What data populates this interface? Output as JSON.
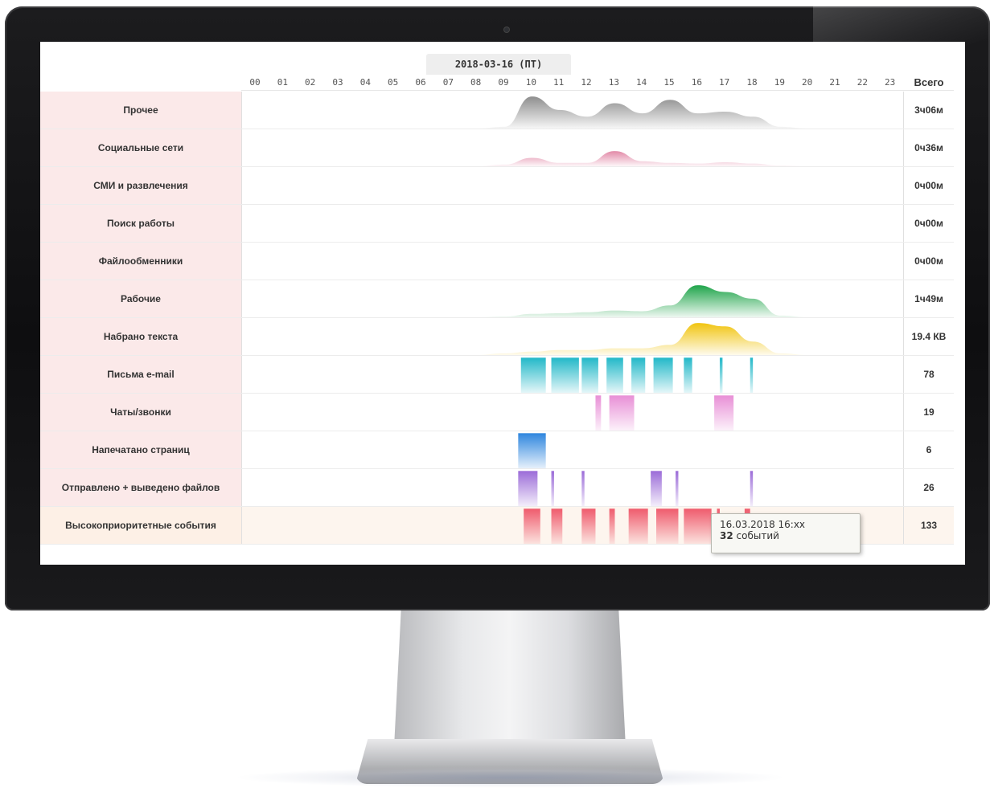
{
  "screen": {
    "date_tab": "2018-03-16 (ПТ)",
    "hours": [
      "00",
      "01",
      "02",
      "03",
      "04",
      "05",
      "06",
      "07",
      "08",
      "09",
      "10",
      "11",
      "12",
      "13",
      "14",
      "15",
      "16",
      "17",
      "18",
      "19",
      "20",
      "21",
      "22",
      "23"
    ],
    "total_header": "Всего"
  },
  "rows": [
    {
      "label": "Прочее",
      "total": "3ч06м",
      "kind": "area",
      "color": "#8e8e8e",
      "profile": [
        0,
        0,
        0,
        0,
        0,
        0,
        0,
        0,
        0,
        0.05,
        0.95,
        0.55,
        0.35,
        0.75,
        0.45,
        0.85,
        0.45,
        0.5,
        0.35,
        0.05,
        0,
        0,
        0,
        0
      ]
    },
    {
      "label": "Социальные сети",
      "total": "0ч36м",
      "kind": "area",
      "color": "#e28aa8",
      "profile": [
        0,
        0,
        0,
        0,
        0,
        0,
        0,
        0,
        0,
        0.05,
        0.25,
        0.1,
        0.1,
        0.45,
        0.15,
        0.1,
        0.08,
        0.12,
        0.08,
        0.02,
        0,
        0,
        0,
        0
      ]
    },
    {
      "label": "СМИ и развлечения",
      "total": "0ч00м",
      "kind": "empty",
      "color": "#cccccc",
      "profile": []
    },
    {
      "label": "Поиск работы",
      "total": "0ч00м",
      "kind": "empty",
      "color": "#cccccc",
      "profile": []
    },
    {
      "label": "Файлообменники",
      "total": "0ч00м",
      "kind": "empty",
      "color": "#cccccc",
      "profile": []
    },
    {
      "label": "Рабочие",
      "total": "1ч49м",
      "kind": "area",
      "color": "#1fa44a",
      "profile": [
        0,
        0,
        0,
        0,
        0,
        0,
        0,
        0,
        0,
        0.02,
        0.1,
        0.12,
        0.15,
        0.2,
        0.18,
        0.35,
        0.95,
        0.75,
        0.55,
        0.05,
        0,
        0,
        0,
        0
      ]
    },
    {
      "label": "Набрано текста",
      "total": "19.4 КВ",
      "kind": "area",
      "color": "#f1c40f",
      "profile": [
        0,
        0,
        0,
        0,
        0,
        0,
        0,
        0,
        0,
        0.05,
        0.1,
        0.15,
        0.15,
        0.2,
        0.2,
        0.3,
        0.95,
        0.85,
        0.4,
        0.05,
        0,
        0,
        0,
        0
      ]
    },
    {
      "label": "Письма e-mail",
      "total": "78",
      "kind": "bars",
      "color": "#22b8c8",
      "bars": [
        [
          10.1,
          11.0,
          0.95
        ],
        [
          11.2,
          12.2,
          0.95
        ],
        [
          12.3,
          12.9,
          0.95
        ],
        [
          13.2,
          13.8,
          0.95
        ],
        [
          14.1,
          14.6,
          0.95
        ],
        [
          14.9,
          15.6,
          0.95
        ],
        [
          16.0,
          16.3,
          0.95
        ],
        [
          17.3,
          17.4,
          0.95
        ],
        [
          18.4,
          18.5,
          0.95
        ]
      ]
    },
    {
      "label": "Чаты/звонки",
      "total": "19",
      "kind": "bars",
      "color": "#e88fd6",
      "bars": [
        [
          12.8,
          13.0,
          0.95
        ],
        [
          13.3,
          14.2,
          0.95
        ],
        [
          17.1,
          17.8,
          0.95
        ]
      ]
    },
    {
      "label": "Напечатано страниц",
      "total": "6",
      "kind": "bars",
      "color": "#2e86de",
      "bars": [
        [
          10.0,
          11.0,
          0.95
        ]
      ]
    },
    {
      "label": "Отправлено + выведено файлов",
      "total": "26",
      "kind": "bars",
      "color": "#9b6cd8",
      "bars": [
        [
          10.0,
          10.7,
          0.95
        ],
        [
          11.2,
          11.3,
          0.95
        ],
        [
          12.3,
          12.4,
          0.95
        ],
        [
          14.8,
          15.2,
          0.95
        ],
        [
          15.7,
          15.8,
          0.95
        ],
        [
          18.4,
          18.5,
          0.95
        ]
      ]
    },
    {
      "label": "Высокоприоритетные события",
      "total": "133",
      "kind": "bars",
      "color": "#ef5b6d",
      "bars": [
        [
          10.2,
          10.8,
          0.95
        ],
        [
          11.2,
          11.6,
          0.95
        ],
        [
          12.3,
          12.8,
          0.95
        ],
        [
          13.3,
          13.5,
          0.95
        ],
        [
          14.0,
          14.7,
          0.95
        ],
        [
          15.0,
          15.8,
          0.95
        ],
        [
          16.0,
          17.0,
          0.95
        ],
        [
          17.2,
          17.3,
          0.95
        ],
        [
          18.2,
          18.4,
          0.95
        ]
      ]
    }
  ],
  "tooltip": {
    "date": "16.03.2018 16:xx",
    "count": "32",
    "unit": "событий"
  }
}
